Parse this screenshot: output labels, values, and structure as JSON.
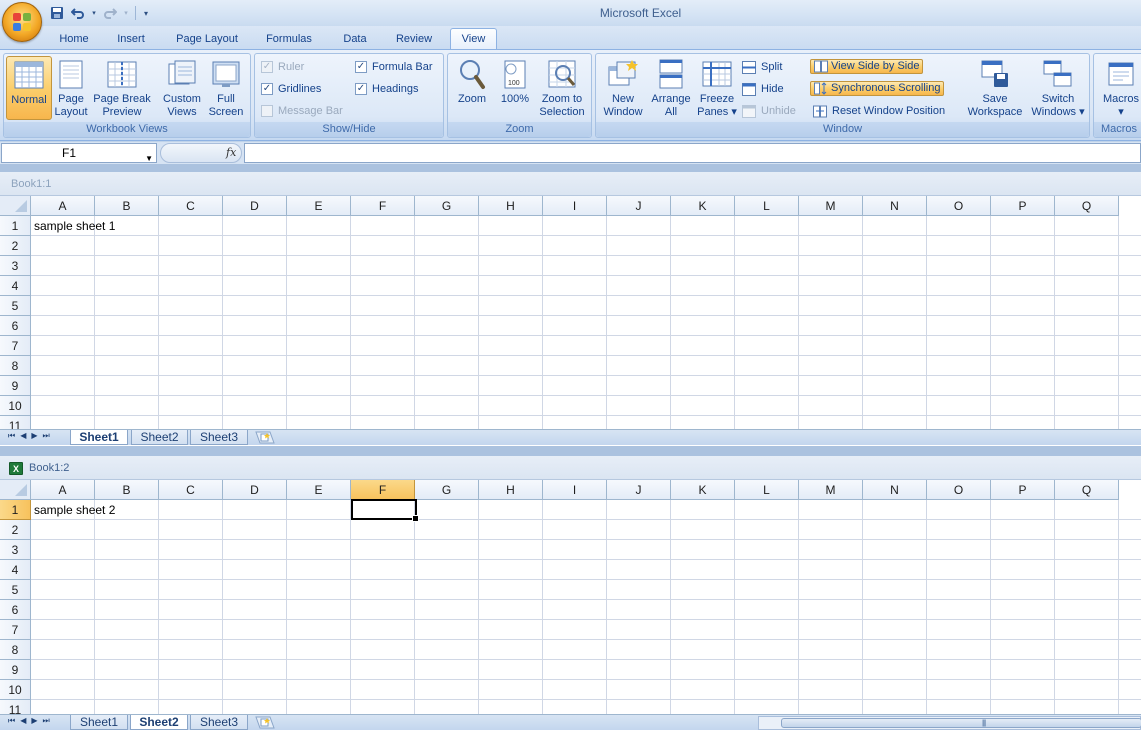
{
  "app": {
    "title": "Microsoft Excel"
  },
  "ribbon_tabs": [
    "Home",
    "Insert",
    "Page Layout",
    "Formulas",
    "Data",
    "Review",
    "View"
  ],
  "active_tab": "View",
  "groups": {
    "workbook_views": {
      "label": "Workbook Views",
      "normal": "Normal",
      "page_layout": [
        "Page",
        "Layout"
      ],
      "page_break": [
        "Page Break",
        "Preview"
      ],
      "custom_views": [
        "Custom",
        "Views"
      ],
      "full_screen": [
        "Full",
        "Screen"
      ]
    },
    "show_hide": {
      "label": "Show/Hide",
      "ruler": "Ruler",
      "gridlines": "Gridlines",
      "message_bar": "Message Bar",
      "formula_bar": "Formula Bar",
      "headings": "Headings"
    },
    "zoom": {
      "label": "Zoom",
      "zoom": "Zoom",
      "hundred": "100%",
      "zoom_sel": [
        "Zoom to",
        "Selection"
      ]
    },
    "window": {
      "label": "Window",
      "new_window": [
        "New",
        "Window"
      ],
      "arrange_all": [
        "Arrange",
        "All"
      ],
      "freeze": [
        "Freeze",
        "Panes ▾"
      ],
      "split": "Split",
      "hide": "Hide",
      "unhide": "Unhide",
      "side_by_side": "View Side by Side",
      "sync_scroll": "Synchronous Scrolling",
      "reset_pos": "Reset Window Position",
      "save_ws": [
        "Save",
        "Workspace"
      ],
      "switch": [
        "Switch",
        "Windows ▾"
      ]
    },
    "macros": {
      "label": "Macros",
      "macros": "Macros",
      "arrow": "▾"
    }
  },
  "formula_bar": {
    "name_box": "F1",
    "fx": "fx",
    "value": ""
  },
  "columns": [
    "A",
    "B",
    "C",
    "D",
    "E",
    "F",
    "G",
    "H",
    "I",
    "J",
    "K",
    "L",
    "M",
    "N",
    "O",
    "P",
    "Q"
  ],
  "rows": [
    "1",
    "2",
    "3",
    "4",
    "5",
    "6",
    "7",
    "8",
    "9",
    "10",
    "11"
  ],
  "window1": {
    "title": "Book1:1",
    "a1": "sample sheet 1",
    "sheets": [
      "Sheet1",
      "Sheet2",
      "Sheet3"
    ],
    "active_sheet": "Sheet1"
  },
  "window2": {
    "title": "Book1:2",
    "a1": "sample sheet 2",
    "sheets": [
      "Sheet1",
      "Sheet2",
      "Sheet3"
    ],
    "active_sheet": "Sheet2",
    "selected_cell": "F1"
  },
  "sheet_nav": [
    "⏮",
    "◀",
    "▶",
    "⏭"
  ],
  "colors": {
    "accent": "#f7c25d",
    "ribbon": "#dae6f5",
    "active_button": "#fbcf6d"
  }
}
